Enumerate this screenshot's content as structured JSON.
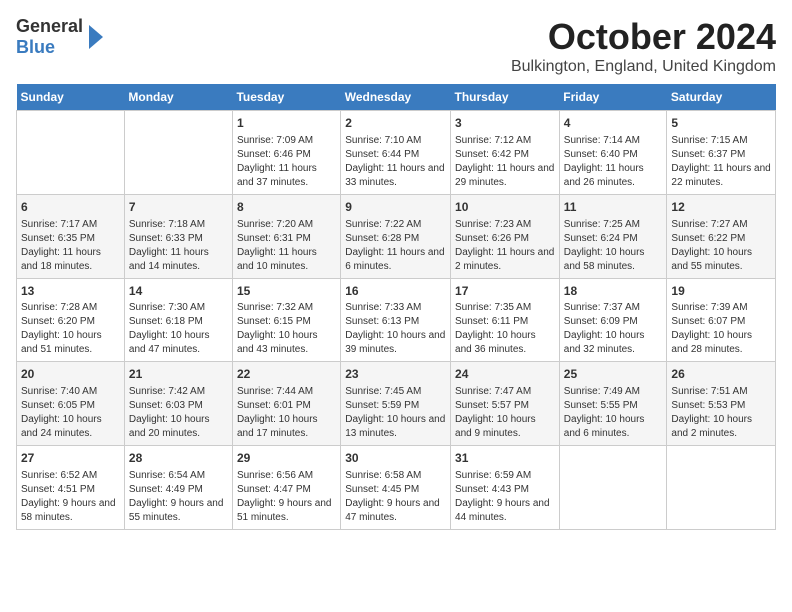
{
  "header": {
    "logo": {
      "general": "General",
      "blue": "Blue"
    },
    "title": "October 2024",
    "subtitle": "Bulkington, England, United Kingdom"
  },
  "days_of_week": [
    "Sunday",
    "Monday",
    "Tuesday",
    "Wednesday",
    "Thursday",
    "Friday",
    "Saturday"
  ],
  "weeks": [
    [
      {
        "day": "",
        "info": ""
      },
      {
        "day": "",
        "info": ""
      },
      {
        "day": "1",
        "info": "Sunrise: 7:09 AM\nSunset: 6:46 PM\nDaylight: 11 hours and 37 minutes."
      },
      {
        "day": "2",
        "info": "Sunrise: 7:10 AM\nSunset: 6:44 PM\nDaylight: 11 hours and 33 minutes."
      },
      {
        "day": "3",
        "info": "Sunrise: 7:12 AM\nSunset: 6:42 PM\nDaylight: 11 hours and 29 minutes."
      },
      {
        "day": "4",
        "info": "Sunrise: 7:14 AM\nSunset: 6:40 PM\nDaylight: 11 hours and 26 minutes."
      },
      {
        "day": "5",
        "info": "Sunrise: 7:15 AM\nSunset: 6:37 PM\nDaylight: 11 hours and 22 minutes."
      }
    ],
    [
      {
        "day": "6",
        "info": "Sunrise: 7:17 AM\nSunset: 6:35 PM\nDaylight: 11 hours and 18 minutes."
      },
      {
        "day": "7",
        "info": "Sunrise: 7:18 AM\nSunset: 6:33 PM\nDaylight: 11 hours and 14 minutes."
      },
      {
        "day": "8",
        "info": "Sunrise: 7:20 AM\nSunset: 6:31 PM\nDaylight: 11 hours and 10 minutes."
      },
      {
        "day": "9",
        "info": "Sunrise: 7:22 AM\nSunset: 6:28 PM\nDaylight: 11 hours and 6 minutes."
      },
      {
        "day": "10",
        "info": "Sunrise: 7:23 AM\nSunset: 6:26 PM\nDaylight: 11 hours and 2 minutes."
      },
      {
        "day": "11",
        "info": "Sunrise: 7:25 AM\nSunset: 6:24 PM\nDaylight: 10 hours and 58 minutes."
      },
      {
        "day": "12",
        "info": "Sunrise: 7:27 AM\nSunset: 6:22 PM\nDaylight: 10 hours and 55 minutes."
      }
    ],
    [
      {
        "day": "13",
        "info": "Sunrise: 7:28 AM\nSunset: 6:20 PM\nDaylight: 10 hours and 51 minutes."
      },
      {
        "day": "14",
        "info": "Sunrise: 7:30 AM\nSunset: 6:18 PM\nDaylight: 10 hours and 47 minutes."
      },
      {
        "day": "15",
        "info": "Sunrise: 7:32 AM\nSunset: 6:15 PM\nDaylight: 10 hours and 43 minutes."
      },
      {
        "day": "16",
        "info": "Sunrise: 7:33 AM\nSunset: 6:13 PM\nDaylight: 10 hours and 39 minutes."
      },
      {
        "day": "17",
        "info": "Sunrise: 7:35 AM\nSunset: 6:11 PM\nDaylight: 10 hours and 36 minutes."
      },
      {
        "day": "18",
        "info": "Sunrise: 7:37 AM\nSunset: 6:09 PM\nDaylight: 10 hours and 32 minutes."
      },
      {
        "day": "19",
        "info": "Sunrise: 7:39 AM\nSunset: 6:07 PM\nDaylight: 10 hours and 28 minutes."
      }
    ],
    [
      {
        "day": "20",
        "info": "Sunrise: 7:40 AM\nSunset: 6:05 PM\nDaylight: 10 hours and 24 minutes."
      },
      {
        "day": "21",
        "info": "Sunrise: 7:42 AM\nSunset: 6:03 PM\nDaylight: 10 hours and 20 minutes."
      },
      {
        "day": "22",
        "info": "Sunrise: 7:44 AM\nSunset: 6:01 PM\nDaylight: 10 hours and 17 minutes."
      },
      {
        "day": "23",
        "info": "Sunrise: 7:45 AM\nSunset: 5:59 PM\nDaylight: 10 hours and 13 minutes."
      },
      {
        "day": "24",
        "info": "Sunrise: 7:47 AM\nSunset: 5:57 PM\nDaylight: 10 hours and 9 minutes."
      },
      {
        "day": "25",
        "info": "Sunrise: 7:49 AM\nSunset: 5:55 PM\nDaylight: 10 hours and 6 minutes."
      },
      {
        "day": "26",
        "info": "Sunrise: 7:51 AM\nSunset: 5:53 PM\nDaylight: 10 hours and 2 minutes."
      }
    ],
    [
      {
        "day": "27",
        "info": "Sunrise: 6:52 AM\nSunset: 4:51 PM\nDaylight: 9 hours and 58 minutes."
      },
      {
        "day": "28",
        "info": "Sunrise: 6:54 AM\nSunset: 4:49 PM\nDaylight: 9 hours and 55 minutes."
      },
      {
        "day": "29",
        "info": "Sunrise: 6:56 AM\nSunset: 4:47 PM\nDaylight: 9 hours and 51 minutes."
      },
      {
        "day": "30",
        "info": "Sunrise: 6:58 AM\nSunset: 4:45 PM\nDaylight: 9 hours and 47 minutes."
      },
      {
        "day": "31",
        "info": "Sunrise: 6:59 AM\nSunset: 4:43 PM\nDaylight: 9 hours and 44 minutes."
      },
      {
        "day": "",
        "info": ""
      },
      {
        "day": "",
        "info": ""
      }
    ]
  ]
}
